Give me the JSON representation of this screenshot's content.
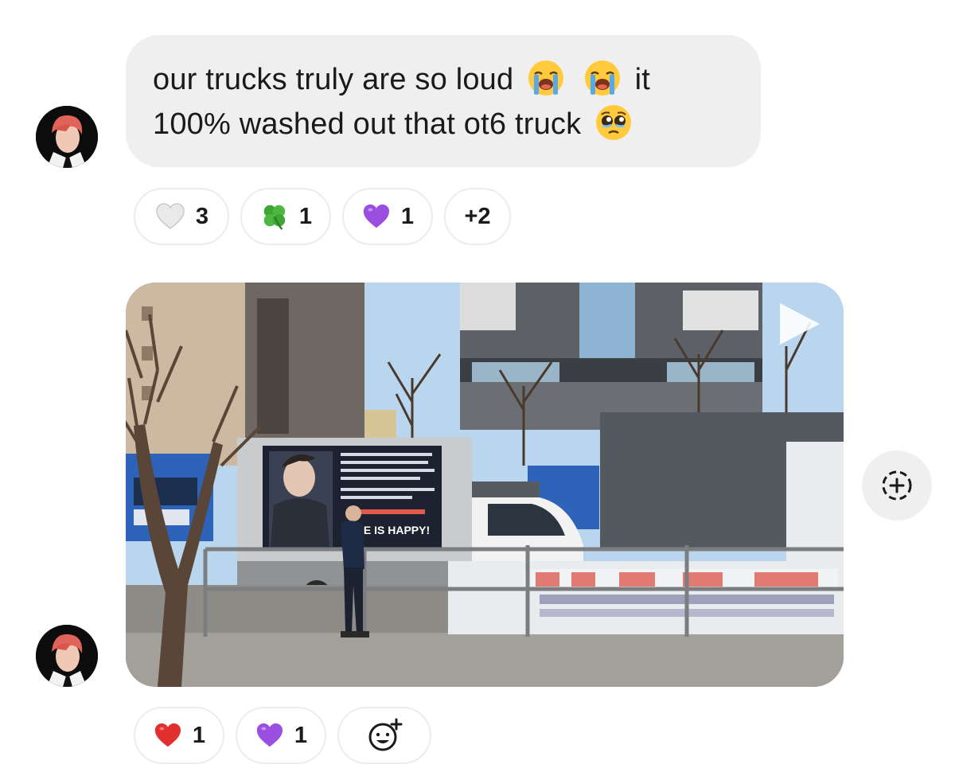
{
  "message_1": {
    "text_line_1": "our trucks truly are so loud",
    "text_line_1_suffix": "it",
    "text_line_2": "100% washed out that ot6 truck",
    "emojis": [
      "loudly-crying-face",
      "loudly-crying-face",
      "pleading-face"
    ]
  },
  "reactions_1": [
    {
      "emoji": "white-heart",
      "count": "3"
    },
    {
      "emoji": "four-leaf-clover",
      "count": "1"
    },
    {
      "emoji": "purple-heart",
      "count": "1"
    },
    {
      "label": "+2"
    }
  ],
  "video_banner": {
    "caption": "ONE IS HAPPY!",
    "play_icon": "play-icon"
  },
  "reactions_2": [
    {
      "emoji": "red-heart",
      "count": "1"
    },
    {
      "emoji": "purple-heart",
      "count": "1"
    },
    {
      "icon": "add-reaction-icon"
    }
  ],
  "save_icon": "add-circle-dashed-icon",
  "colors": {
    "bubble_bg": "#efefef",
    "pill_border": "#ececec",
    "avatar_hair": "#e0645a"
  }
}
